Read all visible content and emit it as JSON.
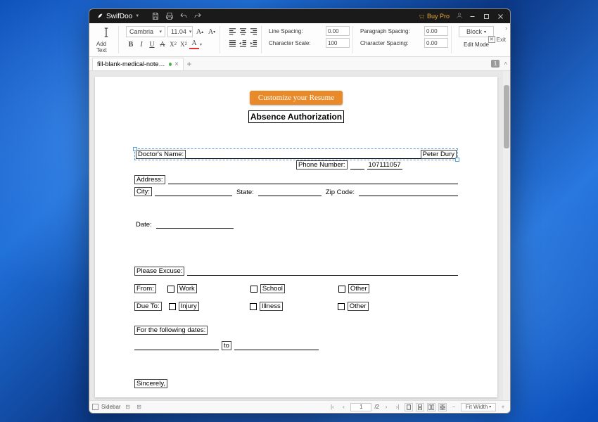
{
  "titlebar": {
    "app_name": "SwifDoo",
    "buy_pro": "Buy Pro"
  },
  "ribbon": {
    "add_text": "Add Text",
    "font_name": "Cambria",
    "font_size": "11.04",
    "line_spacing_label": "Line Spacing:",
    "line_spacing_value": "0.00",
    "para_spacing_label": "Paragraph Spacing:",
    "para_spacing_value": "0.00",
    "char_scale_label": "Character Scale:",
    "char_scale_value": "100",
    "char_spacing_label": "Character Spacing:",
    "char_spacing_value": "0.00",
    "block_label": "Block",
    "edit_mode_label": "Edit Mode",
    "exit_label": "Exit"
  },
  "tabs": {
    "doc_name": "fill-blank-medical-note-templ…",
    "page_badge": "1"
  },
  "doc": {
    "customize_btn": "Customize your Resume",
    "title": "Absence Authorization",
    "doctor_label": "Doctor's Name:",
    "doctor_value": "Peter Dury",
    "phone_label": "Phone Number:",
    "phone_value": "107111057",
    "address_label": "Address:",
    "city_label": "City:",
    "state_label": "State:",
    "zip_label": "Zip Code:",
    "date_label": "Date:",
    "excuse_label": "Please Excuse:",
    "from_label": "From:",
    "work": "Work",
    "school": "School",
    "other1": "Other",
    "dueto_label": "Due To:",
    "injury": "Injury",
    "illness": "Illness",
    "other2": "Other",
    "following_label": "For the following dates:",
    "to_label": "to",
    "sincerely": "Sincerely,"
  },
  "status": {
    "sidebar_label": "Sidebar",
    "current_page": "1",
    "total_pages": "/2",
    "zoom_mode": "Fit Width"
  }
}
